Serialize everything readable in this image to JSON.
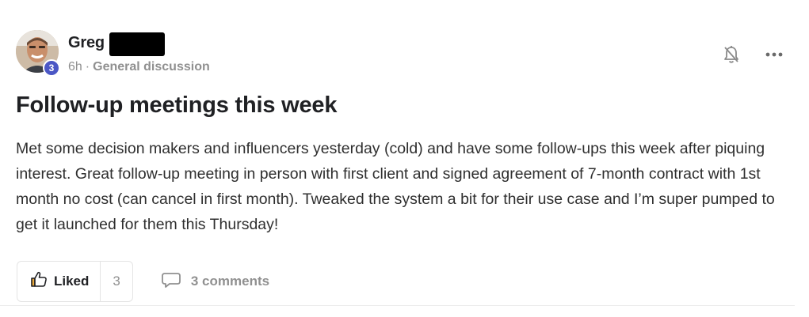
{
  "post": {
    "author": {
      "name": "Greg",
      "level": "3",
      "avatar_icon": "user-avatar-photo"
    },
    "meta": {
      "time": "6h",
      "separator": "·",
      "category": "General discussion"
    },
    "title": "Follow-up meetings this week",
    "body": "Met some decision makers and influencers yesterday (cold) and have some follow-ups this week after piquing interest. Great follow-up meeting in person with first client and signed agreement of 7-month contract with 1st month no cost (can cancel in first month). Tweaked the system a bit for their use case and I’m super pumped to get it launched for them this Thursday!",
    "actions": {
      "like_label": "Liked",
      "like_count": "3",
      "comments_label": "3 comments"
    },
    "icons": {
      "notification": "bell-off-icon",
      "more": "more-options-icon",
      "like": "thumbs-up-icon",
      "comment": "comment-icon"
    },
    "colors": {
      "level_badge": "#4b57c5",
      "muted_text": "#909090",
      "primary_text": "#202124"
    }
  }
}
